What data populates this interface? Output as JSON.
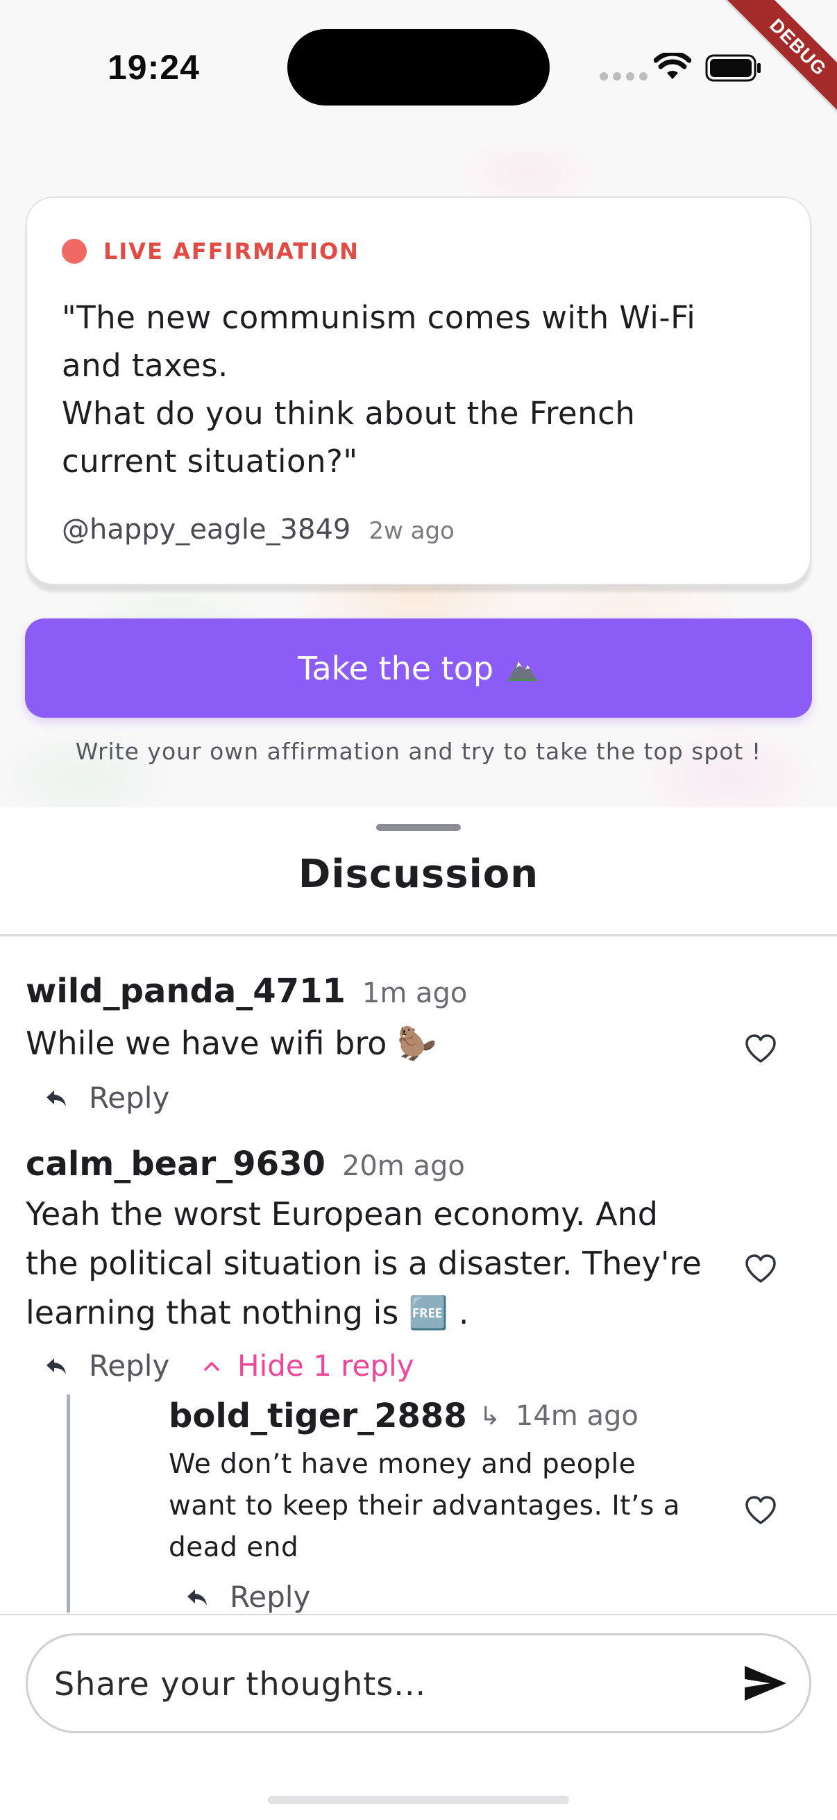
{
  "status_bar": {
    "time": "19:24",
    "debug_label": "DEBUG"
  },
  "affirmation": {
    "live_label": "LIVE AFFIRMATION",
    "quote_lines": [
      "\"The new communism comes with Wi-Fi",
      "and taxes.",
      "What do you think about the French",
      "current situation?\""
    ],
    "author": "@happy_eagle_3849",
    "time_ago": "2w ago"
  },
  "cta": {
    "label": "Take the top",
    "icon": "mountain-icon",
    "hint": "Write your own affirmation and try to take the top spot !"
  },
  "discussion": {
    "title": "Discussion",
    "comments": [
      {
        "user": "wild_panda_4711",
        "time": "1m ago",
        "text_lines": [
          "While we have wifi bro 🦫"
        ],
        "reply_label": "Reply"
      },
      {
        "user": "calm_bear_9630",
        "time": "20m ago",
        "text_lines": [
          "Yeah the worst European economy. And",
          "the political situation is a disaster. They're",
          "learning that nothing is 🆓 ."
        ],
        "reply_label": "Reply",
        "hide_replies_label": "Hide 1 reply",
        "replies": [
          {
            "user": "bold_tiger_2888",
            "arrow": "↳",
            "time": "14m ago",
            "text_lines": [
              "We don’t have money and people",
              "want to keep their advantages. It’s a",
              "dead end"
            ],
            "reply_label": "Reply"
          }
        ]
      }
    ]
  },
  "composer": {
    "placeholder": "Share your thoughts..."
  },
  "colors": {
    "accent": "#8b5cf6",
    "live": "#e24a44",
    "hide_replies": "#ec4899"
  }
}
